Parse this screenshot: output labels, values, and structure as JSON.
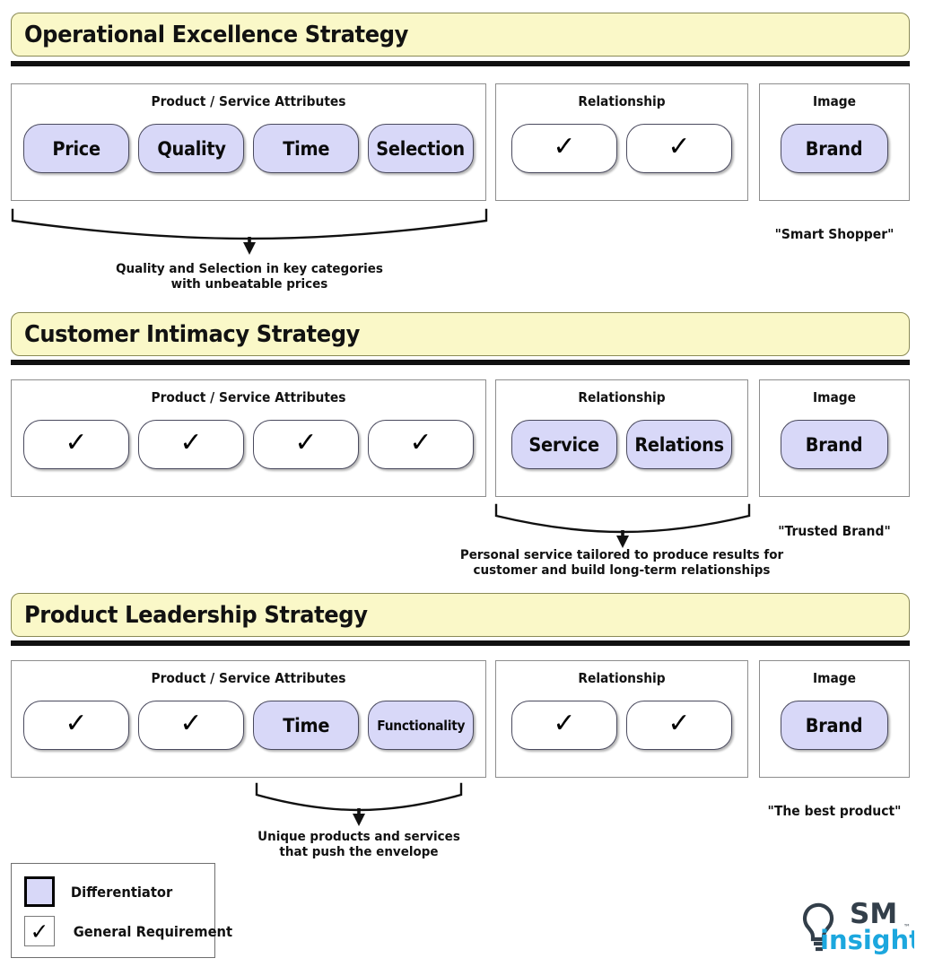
{
  "legend": {
    "items": [
      {
        "icon": "lavender-square",
        "label": "Differentiator"
      },
      {
        "icon": "checkmark-square",
        "label": "General Requirement",
        "glyph": "✓"
      }
    ]
  },
  "logo": {
    "icon": "lightbulb-icon",
    "mark_text": "SM",
    "word_text": "insight",
    "tm": "™",
    "mark_color": "#333f4a",
    "word_color": "#1CA7DE"
  },
  "colors": {
    "banner_fill": "#FAF8C8",
    "banner_border": "#8a8a56",
    "differentiator_fill": "#D8D8F8",
    "panel_border": "#8d8d8d",
    "rule": "#111111"
  },
  "check_glyph": "✓",
  "blocks": [
    {
      "title": "Operational Excellence Strategy",
      "panels": {
        "attributes": {
          "header": "Product / Service Attributes",
          "cells": [
            {
              "type": "differentiator",
              "label": "Price",
              "size": "normal"
            },
            {
              "type": "differentiator",
              "label": "Quality",
              "size": "normal"
            },
            {
              "type": "differentiator",
              "label": "Time",
              "size": "normal"
            },
            {
              "type": "differentiator",
              "label": "Selection",
              "size": "normal"
            }
          ]
        },
        "relationship": {
          "header": "Relationship",
          "cells": [
            {
              "type": "requirement",
              "label": "✓"
            },
            {
              "type": "requirement",
              "label": "✓"
            }
          ]
        },
        "image": {
          "header": "Image",
          "cells": [
            {
              "type": "differentiator",
              "label": "Brand",
              "size": "normal"
            }
          ]
        }
      },
      "brace_caption": "Quality and Selection in key categories\nwith unbeatable prices",
      "brace_over": "attributes",
      "tagline": "\"Smart Shopper\""
    },
    {
      "title": "Customer Intimacy Strategy",
      "panels": {
        "attributes": {
          "header": "Product / Service Attributes",
          "cells": [
            {
              "type": "requirement",
              "label": "✓"
            },
            {
              "type": "requirement",
              "label": "✓"
            },
            {
              "type": "requirement",
              "label": "✓"
            },
            {
              "type": "requirement",
              "label": "✓"
            }
          ]
        },
        "relationship": {
          "header": "Relationship",
          "cells": [
            {
              "type": "differentiator",
              "label": "Service",
              "size": "normal"
            },
            {
              "type": "differentiator",
              "label": "Relations",
              "size": "normal"
            }
          ]
        },
        "image": {
          "header": "Image",
          "cells": [
            {
              "type": "differentiator",
              "label": "Brand",
              "size": "normal"
            }
          ]
        }
      },
      "brace_caption": "Personal service tailored to produce results for\ncustomer and build long-term relationships",
      "brace_over": "relationship",
      "tagline": "\"Trusted Brand\""
    },
    {
      "title": "Product Leadership Strategy",
      "panels": {
        "attributes": {
          "header": "Product / Service Attributes",
          "cells": [
            {
              "type": "requirement",
              "label": "✓"
            },
            {
              "type": "requirement",
              "label": "✓"
            },
            {
              "type": "differentiator",
              "label": "Time",
              "size": "normal"
            },
            {
              "type": "differentiator",
              "label": "Functionality",
              "size": "small"
            }
          ]
        },
        "relationship": {
          "header": "Relationship",
          "cells": [
            {
              "type": "requirement",
              "label": "✓"
            },
            {
              "type": "requirement",
              "label": "✓"
            }
          ]
        },
        "image": {
          "header": "Image",
          "cells": [
            {
              "type": "differentiator",
              "label": "Brand",
              "size": "normal"
            }
          ]
        }
      },
      "brace_caption": "Unique products and services\nthat push the envelope",
      "brace_over": "attributes-right",
      "tagline": "\"The best product\""
    }
  ]
}
